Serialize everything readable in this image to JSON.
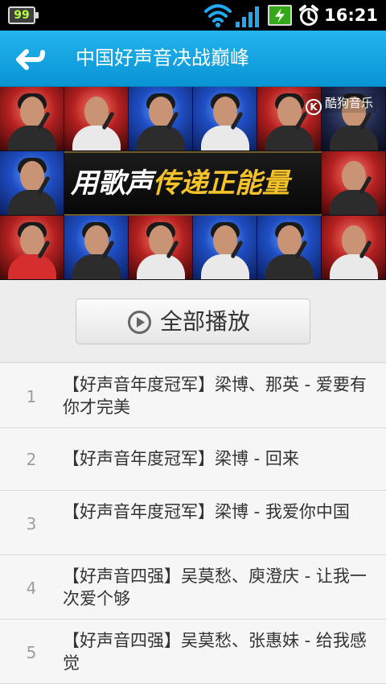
{
  "status_bar": {
    "battery_level": "99",
    "time": "16:21",
    "icons": [
      "wifi-icon",
      "signal-icon",
      "charging-icon",
      "alarm-icon"
    ]
  },
  "header": {
    "title": "中国好声音决战巅峰",
    "back_icon": "back-arrow-icon"
  },
  "banner": {
    "slogan_parts": [
      "用歌声",
      "传递正能量"
    ],
    "brand": "酷狗音乐",
    "brand_mark": "K"
  },
  "play_all": {
    "label": "全部播放",
    "icon": "play-circle-icon"
  },
  "songs": [
    {
      "index": "1",
      "title": "【好声音年度冠军】梁博、那英 - 爱要有你才完美"
    },
    {
      "index": "2",
      "title": "【好声音年度冠军】梁博 - 回来"
    },
    {
      "index": "3",
      "title": "【好声音年度冠军】梁博 - 我爱你中国"
    },
    {
      "index": "4",
      "title": "【好声音四强】吴莫愁、庾澄庆 - 让我一次爱个够"
    },
    {
      "index": "5",
      "title": "【好声音四强】吴莫愁、张惠妹 - 给我感觉"
    }
  ],
  "colors": {
    "title_bar": "#1aa8e8",
    "status_bar": "#000000",
    "list_background": "#f6f6f6",
    "accent_yellow": "#f4c229"
  }
}
